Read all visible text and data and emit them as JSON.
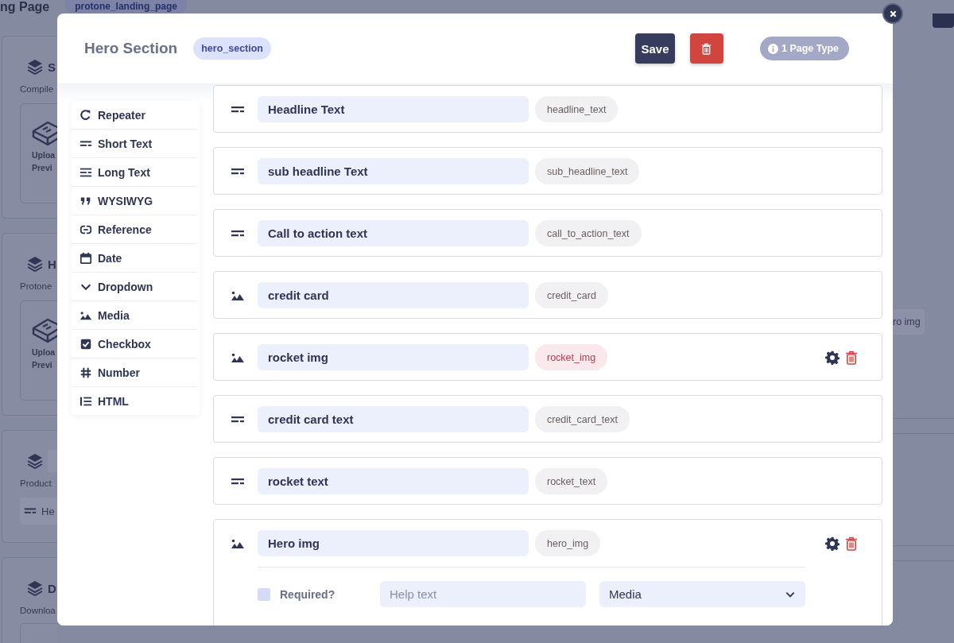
{
  "background": {
    "page_title": "ng Page",
    "page_slug": "protone_landing_page",
    "cards": [
      {
        "kind": "upload",
        "title": "S",
        "description": "Compile",
        "upload_label": "Uploa",
        "preview_label": "Previ"
      },
      {
        "kind": "upload",
        "title": "H",
        "description": "Protone",
        "upload_label": "Uploa",
        "preview_label": "Previ"
      },
      {
        "kind": "fields",
        "description": "Product",
        "field_label": "He"
      },
      {
        "kind": "download",
        "title": "D",
        "description": "Downloa"
      }
    ],
    "side_tag": "ro img"
  },
  "modal": {
    "title": "Hero Section",
    "slug": "hero_section",
    "save_label": "Save",
    "page_type_label": "1 Page Type",
    "field_types": [
      {
        "kind": "repeater",
        "label": "Repeater"
      },
      {
        "kind": "short_text",
        "label": "Short Text"
      },
      {
        "kind": "long_text",
        "label": "Long Text"
      },
      {
        "kind": "wysiwyg",
        "label": "WYSIWYG"
      },
      {
        "kind": "reference",
        "label": "Reference"
      },
      {
        "kind": "date",
        "label": "Date"
      },
      {
        "kind": "dropdown",
        "label": "Dropdown"
      },
      {
        "kind": "media",
        "label": "Media"
      },
      {
        "kind": "checkbox",
        "label": "Checkbox"
      },
      {
        "kind": "number",
        "label": "Number"
      },
      {
        "kind": "html",
        "label": "HTML"
      }
    ],
    "fields": [
      {
        "kind": "short_text",
        "label": "Headline Text",
        "key": "headline_text",
        "hovered": false,
        "expanded": false
      },
      {
        "kind": "short_text",
        "label": "sub headline Text",
        "key": "sub_headline_text",
        "hovered": false,
        "expanded": false
      },
      {
        "kind": "short_text",
        "label": "Call to action text",
        "key": "call_to_action_text",
        "hovered": false,
        "expanded": false
      },
      {
        "kind": "media",
        "label": "credit card",
        "key": "credit_card",
        "hovered": false,
        "expanded": false
      },
      {
        "kind": "media",
        "label": "rocket img",
        "key": "rocket_img",
        "hovered": true,
        "expanded": false
      },
      {
        "kind": "short_text",
        "label": "credit card text",
        "key": "credit_card_text",
        "hovered": false,
        "expanded": false
      },
      {
        "kind": "short_text",
        "label": "rocket text",
        "key": "rocket_text",
        "hovered": false,
        "expanded": false
      },
      {
        "kind": "media",
        "label": "Hero img",
        "key": "hero_img",
        "hovered": false,
        "expanded": true,
        "options": {
          "required_label": "Required?",
          "required": false,
          "help_placeholder": "Help text",
          "type_value": "Media"
        }
      }
    ]
  }
}
